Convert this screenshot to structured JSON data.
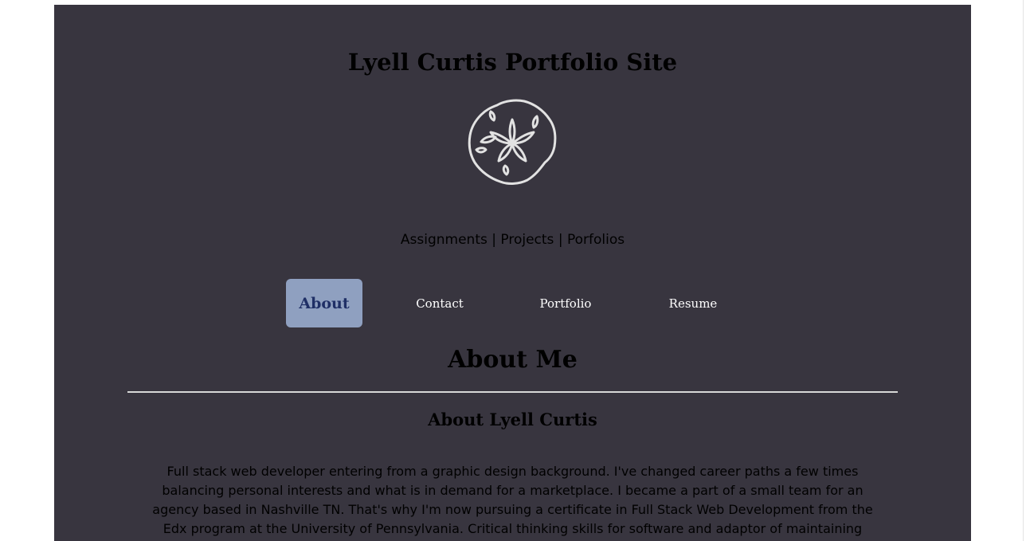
{
  "header": {
    "title": "Lyell Curtis Portfolio Site",
    "logo_icon": "sand-dollar-icon",
    "tagline": "Assignments | Projects | Porfolios"
  },
  "nav": {
    "items": [
      {
        "label": "About",
        "active": true
      },
      {
        "label": "Contact",
        "active": false
      },
      {
        "label": "Portfolio",
        "active": false
      },
      {
        "label": "Resume",
        "active": false
      }
    ]
  },
  "main": {
    "heading": "About Me",
    "subheading": "About Lyell Curtis",
    "bio": "Full stack web developer entering from a graphic design background. I've changed career paths a few times balancing personal interests and what is in demand for a marketplace. I became a part of a small team for an agency based in Nashville TN. That's why I'm now pursuing a certificate in Full Stack Web Development from the Edx program at the University of Pennsylvania. Critical thinking skills for software and adaptor of maintaining"
  },
  "colors": {
    "page_background": "#38353f",
    "active_tab_background": "#8fa0c0",
    "active_tab_text": "#1f2f66",
    "nav_text": "#ffffff",
    "divider": "#d8d8d8"
  }
}
